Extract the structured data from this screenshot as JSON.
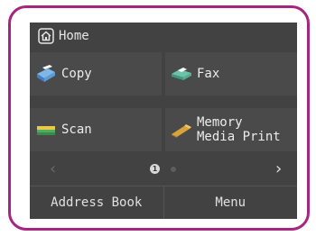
{
  "header": {
    "title": "Home"
  },
  "tiles": [
    {
      "label": "Copy",
      "icon": "copy-icon"
    },
    {
      "label": "Fax",
      "icon": "fax-icon"
    },
    {
      "label": "Scan",
      "icon": "scan-icon"
    },
    {
      "label": "Memory\nMedia Print",
      "icon": "memory-media-icon"
    }
  ],
  "pager": {
    "current_page": "1",
    "page_count": 2
  },
  "bottom": {
    "address_book": "Address Book",
    "menu": "Menu"
  },
  "colors": {
    "frame": "#a8257f",
    "screen": "#424242"
  }
}
